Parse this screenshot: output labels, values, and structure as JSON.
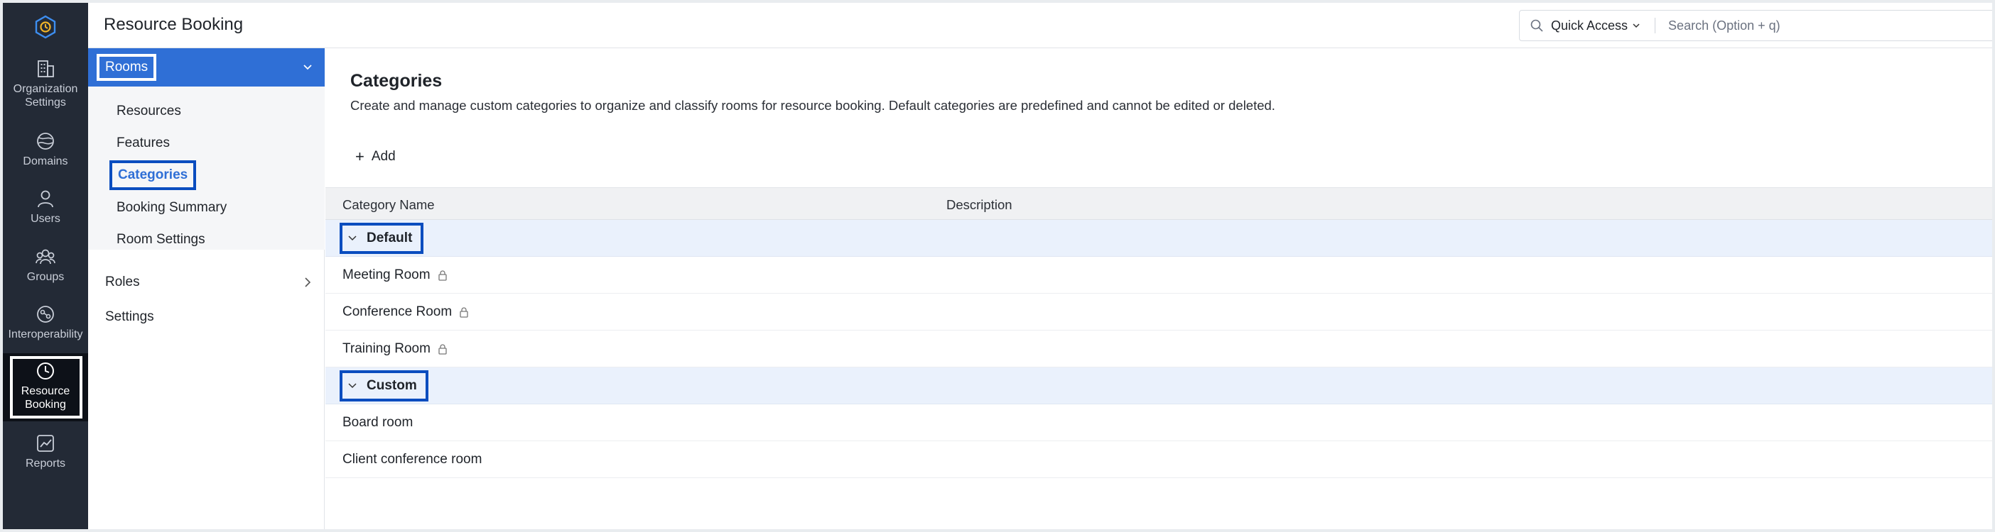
{
  "header": {
    "title": "Resource Booking",
    "quick_access": "Quick Access",
    "search_placeholder": "Search (Option + q)"
  },
  "rail": {
    "items": [
      {
        "label": "Organization Settings",
        "icon": "building-icon"
      },
      {
        "label": "Domains",
        "icon": "globe-icon"
      },
      {
        "label": "Users",
        "icon": "user-icon"
      },
      {
        "label": "Groups",
        "icon": "groups-icon"
      },
      {
        "label": "Interoperability",
        "icon": "interoperability-icon"
      },
      {
        "label": "Resource Booking",
        "icon": "clock-icon",
        "active": true
      },
      {
        "label": "Reports",
        "icon": "chart-icon"
      }
    ]
  },
  "subnav": {
    "rooms": "Rooms",
    "rooms_children": [
      "Resources",
      "Features",
      "Categories",
      "Booking Summary",
      "Room Settings"
    ],
    "active_child": "Categories",
    "roles": "Roles",
    "settings": "Settings"
  },
  "main": {
    "title": "Categories",
    "description": "Create and manage custom categories to organize and classify rooms for resource booking. Default categories are predefined and cannot be edited or deleted.",
    "add_label": "Add",
    "columns": [
      "Category Name",
      "Description"
    ],
    "groups": [
      {
        "label": "Default",
        "rows": [
          "Meeting Room",
          "Conference Room",
          "Training Room"
        ],
        "locked": true
      },
      {
        "label": "Custom",
        "rows": [
          "Board room",
          "Client conference room"
        ],
        "locked": false
      }
    ]
  },
  "colors": {
    "rail_bg": "#232a36",
    "accent": "#2f6fd6",
    "highlight_border": "#0a4dbf",
    "group_bg": "#eaf1fc"
  }
}
